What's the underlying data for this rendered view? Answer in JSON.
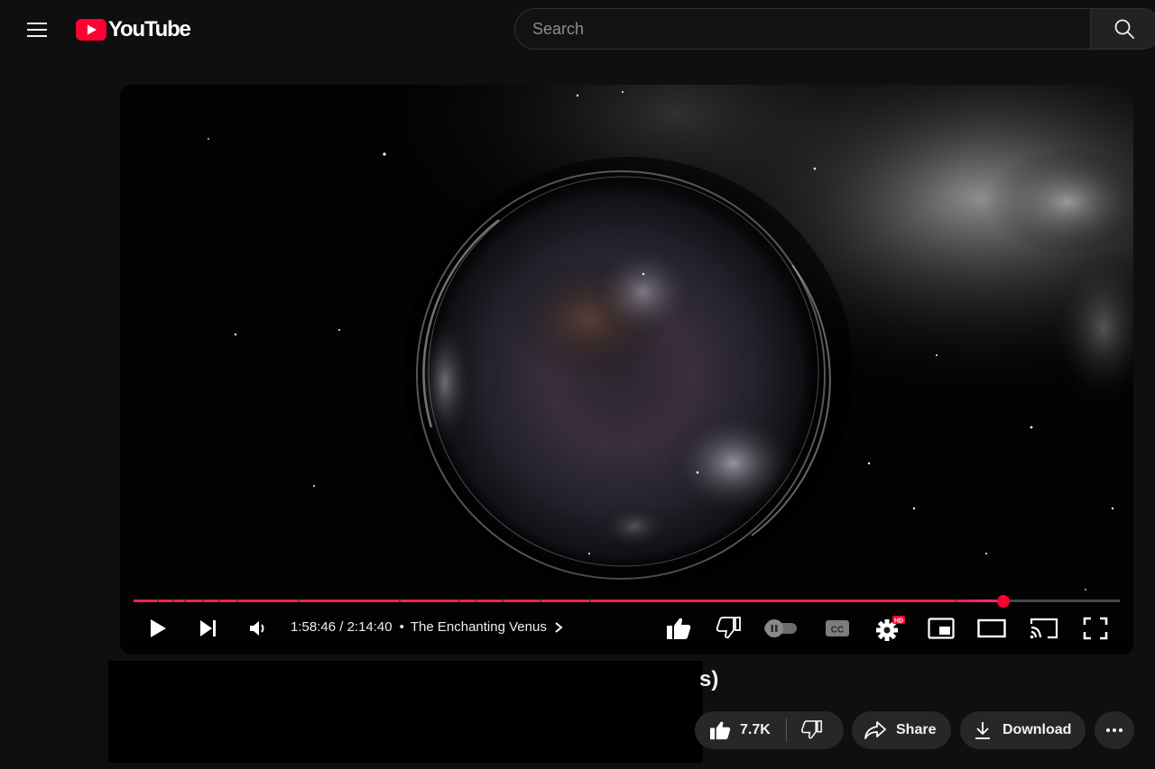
{
  "masthead": {
    "logo_text": "YouTube",
    "search_placeholder": "Search",
    "icons": {
      "menu": "hamburger-menu-icon",
      "search": "magnifier-icon",
      "logo": "youtube-play-logo"
    }
  },
  "player": {
    "current_time": "1:58:46",
    "duration": "2:14:40",
    "time_separator": " / ",
    "chapter_title": "The Enchanting Venus",
    "progress_fraction": 0.882,
    "played_color": "#f0254e",
    "scrubber_color": "#ff0033",
    "settings_badge": "HD",
    "captions_label": "CC",
    "autoplay": "off",
    "controls": [
      "play",
      "next",
      "volume",
      "like",
      "dislike",
      "autoplay-toggle",
      "captions",
      "settings",
      "miniplayer",
      "theater-mode",
      "cast",
      "fullscreen"
    ]
  },
  "video": {
    "title_visible_tail": "s)"
  },
  "actions": {
    "like_count": "7.7K",
    "share_label": "Share",
    "download_label": "Download"
  },
  "colors": {
    "background": "#0f0f0f",
    "brand_red": "#ff0033",
    "pill_bg": "#272727"
  }
}
